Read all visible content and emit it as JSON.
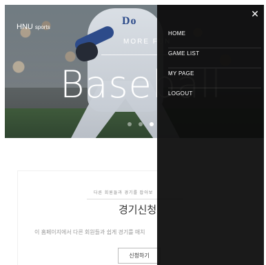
{
  "brand": {
    "main": "HNU",
    "sub": "sports"
  },
  "hero": {
    "subtitle": "MORE FUN",
    "title": "Baseball",
    "jersey": "Do"
  },
  "slider": {
    "dots": 3,
    "active_index": 2
  },
  "card": {
    "eyebrow": "다른 회원들과 경기를 잡아보",
    "title": "경기신청",
    "description": "이 홈페이지에서 다른 회원들과 쉽게 경기를 매치",
    "button": "신청하기"
  },
  "menu": {
    "close_icon": "close-icon",
    "items": [
      {
        "label": "HOME"
      },
      {
        "label": "GAME LIST"
      },
      {
        "label": "MY PAGE"
      },
      {
        "label": "LOGOUT"
      }
    ]
  }
}
